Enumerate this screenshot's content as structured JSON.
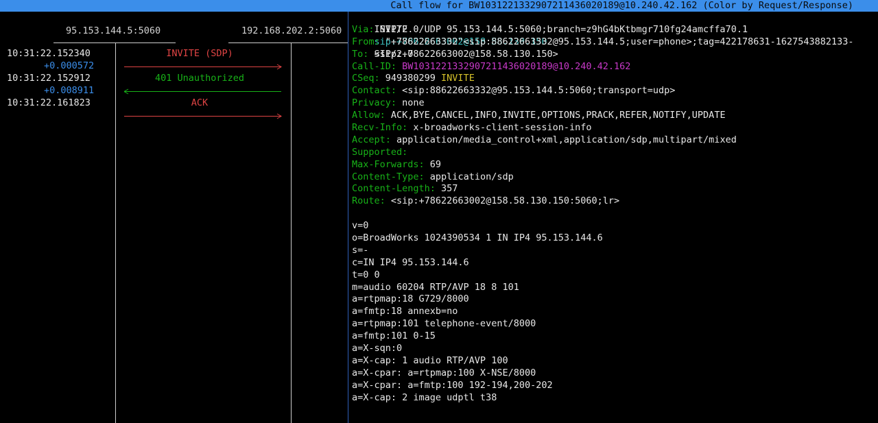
{
  "title": "Call flow for BW10312213329072114360201​89@10.240.42.162 (Color by Request/Response)",
  "hosts": [
    "95.153.144.5:5060",
    "192.168.202.2:5060"
  ],
  "timestamps": [
    {
      "text": "10:31:22.152340",
      "kind": "time"
    },
    {
      "text": "+0.000572",
      "kind": "delta"
    },
    {
      "text": "10:31:22.152912",
      "kind": "time"
    },
    {
      "text": "+0.008911",
      "kind": "delta"
    },
    {
      "text": "10:31:22.161823",
      "kind": "time"
    }
  ],
  "messages": [
    {
      "label": "INVITE (SDP)",
      "direction": "right",
      "color": "#e04444"
    },
    {
      "label": "401 Unauthorized",
      "direction": "left",
      "color": "#18b218"
    },
    {
      "label": "ACK",
      "direction": "right",
      "color": "#e04444"
    }
  ],
  "sip": {
    "request_line": {
      "method": "INVITE",
      "uri": "sip:+78622663002@158.58.130.150",
      "version": "SIP/2.0"
    },
    "headers": [
      {
        "name": "Via:",
        "value": "SIP/2.0/UDP 95.153.144.5:5060;branch=z9hG4bKtbmgr710fg24amcffa70.1"
      },
      {
        "name": "From:",
        "value": "\"+78622663332\"<sip:88622663332@95.153.144.5;user=phone>;tag=422178631-1627543882133-"
      },
      {
        "name": "To:",
        "value": "<sip:+78622663002@158.58.130.150>"
      },
      {
        "name": "Call-ID:",
        "value": "BW10312213329072114360201​89@10.240.42.162"
      },
      {
        "name": "CSeq:",
        "value": "949380299",
        "method": "INVITE"
      },
      {
        "name": "Contact:",
        "value": "<sip:88622663332@95.153.144.5:5060;transport=udp>"
      },
      {
        "name": "Privacy:",
        "value": "none"
      },
      {
        "name": "Allow:",
        "value": "ACK,BYE,CANCEL,INFO,INVITE,OPTIONS,PRACK,REFER,NOTIFY,UPDATE"
      },
      {
        "name": "Recv-Info:",
        "value": "x-broadworks-client-session-info"
      },
      {
        "name": "Accept:",
        "value": "application/media_control+xml,application/sdp,multipart/mixed"
      },
      {
        "name": "Supported:",
        "value": ""
      },
      {
        "name": "Max-Forwards:",
        "value": "69"
      },
      {
        "name": "Content-Type:",
        "value": "application/sdp"
      },
      {
        "name": "Content-Length:",
        "value": "357"
      },
      {
        "name": "Route:",
        "value": "<sip:+78622663002@158.58.130.150:5060;lr>"
      }
    ],
    "body": [
      "v=0",
      "o=BroadWorks 1024390534 1 IN IP4 95.153.144.6",
      "s=-",
      "c=IN IP4 95.153.144.6",
      "t=0 0",
      "m=audio 60204 RTP/AVP 18 8 101",
      "a=rtpmap:18 G729/8000",
      "a=fmtp:18 annexb=no",
      "a=rtpmap:101 telephone-event/8000",
      "a=fmtp:101 0-15",
      "a=X-sqn:0",
      "a=X-cap: 1 audio RTP/AVP 100",
      "a=X-cpar: a=rtpmap:100 X-NSE/8000",
      "a=X-cpar: a=fmtp:100 192-194,200-202",
      "a=X-cap: 2 image udptl t38"
    ]
  }
}
